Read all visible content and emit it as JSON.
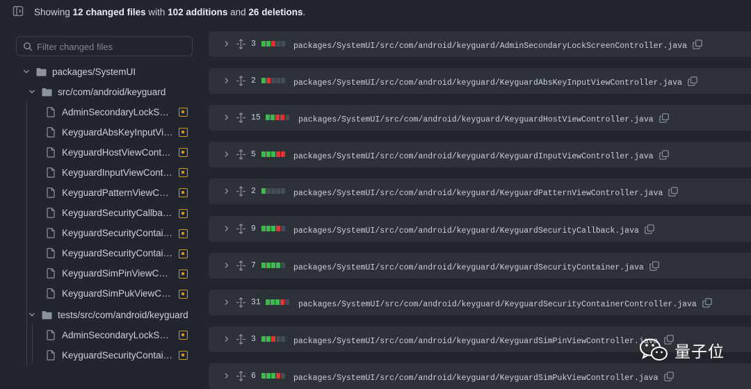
{
  "summary": {
    "prefix": "Showing ",
    "files": "12 changed files",
    "with": " with ",
    "additions": "102 additions",
    "and": " and ",
    "deletions": "26 deletions",
    "suffix": "."
  },
  "filter": {
    "placeholder": "Filter changed files"
  },
  "tree": {
    "root": "packages/SystemUI",
    "src_folder": "src/com/android/keyguard",
    "src_files": [
      "AdminSecondaryLockScreenController.java",
      "KeyguardAbsKeyInputViewController.java",
      "KeyguardHostViewController.java",
      "KeyguardInputViewController.java",
      "KeyguardPatternViewController.java",
      "KeyguardSecurityCallback.java",
      "KeyguardSecurityContainer.java",
      "KeyguardSecurityContainerController.java",
      "KeyguardSimPinViewController.java",
      "KeyguardSimPukViewController.java"
    ],
    "tests_folder": "tests/src/com/android/keyguard",
    "tests_files": [
      "AdminSecondaryLockScreenControllerTest.java",
      "KeyguardSecurityContainerControllerTest.java"
    ]
  },
  "diff_files": [
    {
      "count": "3",
      "bar": [
        "add",
        "add",
        "del",
        "neu",
        "neu"
      ],
      "path": "packages/SystemUI/src/com/android/keyguard/AdminSecondaryLockScreenController.java"
    },
    {
      "count": "2",
      "bar": [
        "add",
        "del",
        "neu",
        "neu",
        "neu"
      ],
      "path": "packages/SystemUI/src/com/android/keyguard/KeyguardAbsKeyInputViewController.java"
    },
    {
      "count": "15",
      "bar": [
        "add",
        "add",
        "del",
        "del",
        "neu"
      ],
      "path": "packages/SystemUI/src/com/android/keyguard/KeyguardHostViewController.java"
    },
    {
      "count": "5",
      "bar": [
        "add",
        "add",
        "add",
        "del",
        "del"
      ],
      "path": "packages/SystemUI/src/com/android/keyguard/KeyguardInputViewController.java"
    },
    {
      "count": "2",
      "bar": [
        "add",
        "neu",
        "neu",
        "neu",
        "neu"
      ],
      "path": "packages/SystemUI/src/com/android/keyguard/KeyguardPatternViewController.java"
    },
    {
      "count": "9",
      "bar": [
        "add",
        "add",
        "add",
        "del",
        "neu"
      ],
      "path": "packages/SystemUI/src/com/android/keyguard/KeyguardSecurityCallback.java"
    },
    {
      "count": "7",
      "bar": [
        "add",
        "add",
        "add",
        "add",
        "neu"
      ],
      "path": "packages/SystemUI/src/com/android/keyguard/KeyguardSecurityContainer.java"
    },
    {
      "count": "31",
      "bar": [
        "add",
        "add",
        "add",
        "del",
        "neu"
      ],
      "path": "packages/SystemUI/src/com/android/keyguard/KeyguardSecurityContainerController.java"
    },
    {
      "count": "3",
      "bar": [
        "add",
        "add",
        "del",
        "neu",
        "neu"
      ],
      "path": "packages/SystemUI/src/com/android/keyguard/KeyguardSimPinViewController.java"
    },
    {
      "count": "6",
      "bar": [
        "add",
        "add",
        "add",
        "del",
        "neu"
      ],
      "path": "packages/SystemUI/src/com/android/keyguard/KeyguardSimPukViewController.java"
    }
  ],
  "watermark": {
    "text": "量子位"
  },
  "colors": {
    "addition": "#3fb950",
    "deletion": "#da3633",
    "neutral": "#444c56",
    "modified": "#d29922",
    "background": "#22262c"
  }
}
